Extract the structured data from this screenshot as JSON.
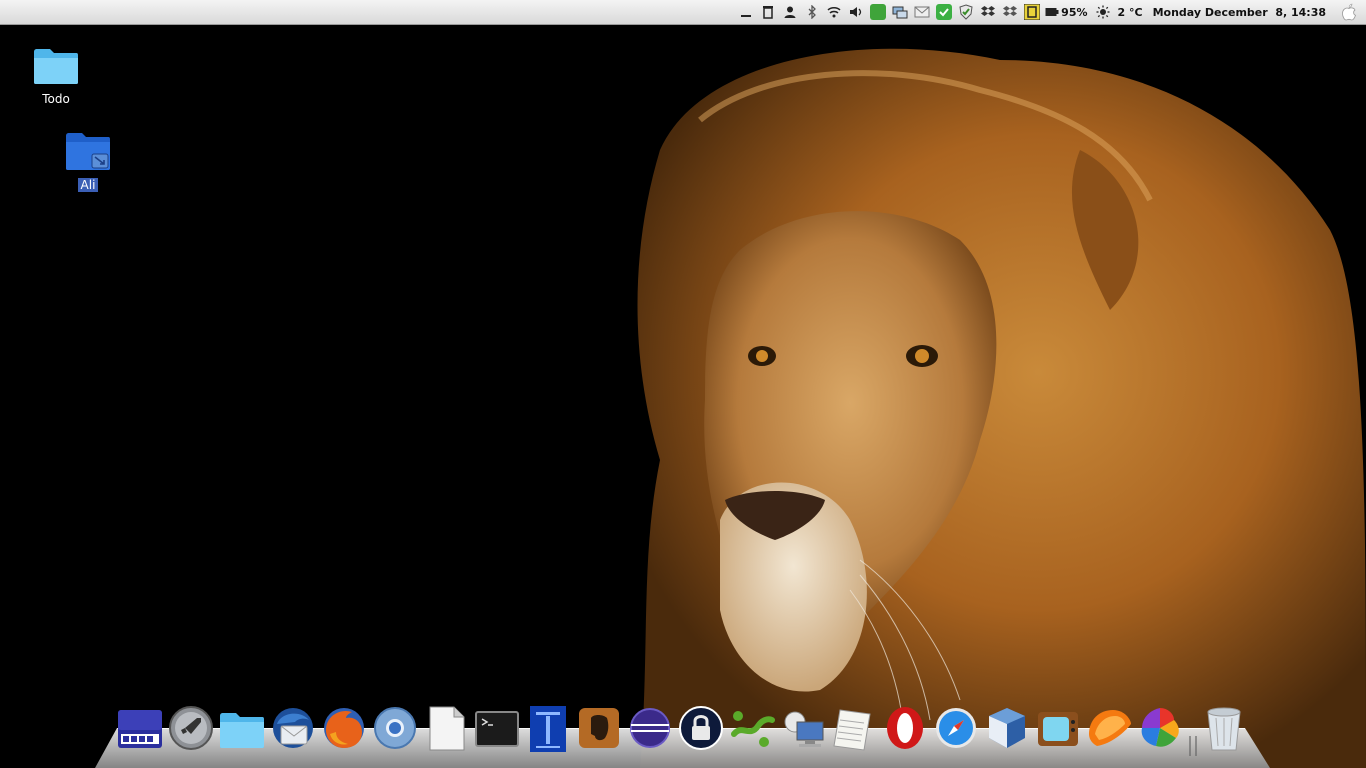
{
  "top_panel": {
    "tray_icons": [
      "minimize-window-icon",
      "trash-panel-icon",
      "user-icon",
      "bluetooth-icon",
      "wifi-icon",
      "volume-icon",
      "evernote-tray-icon",
      "network-tray-icon",
      "mail-tray-icon",
      "check-green-icon",
      "shield-check-icon",
      "dropbox-icon",
      "dropbox-alt-icon",
      "keyboard-layout-icon"
    ],
    "battery": "95%",
    "weather_icon": "sun-icon",
    "temperature": "2 °C",
    "clock": "Monday December  8, 14:38",
    "apple_menu_icon": "apple-icon"
  },
  "desktop": {
    "icons": [
      {
        "label": "Todo",
        "icon": "folder-light-blue-icon"
      },
      {
        "label": "Ali",
        "icon": "folder-link-blue-icon"
      }
    ]
  },
  "dock": {
    "items": [
      "screen-keyboard-icon",
      "launchpad-rocket-icon",
      "files-folder-icon",
      "thunderbird-icon",
      "firefox-icon",
      "chromium-icon",
      "text-document-icon",
      "terminal-icon",
      "typewriter-app-icon",
      "evernote-icon",
      "eclipse-icon",
      "password-lock-icon",
      "network-share-icon",
      "remote-desktop-icon",
      "notes-pad-icon",
      "opera-icon",
      "safari-compass-icon",
      "virtualbox-icon",
      "tv-app-icon",
      "orange-slice-icon",
      "picasa-icon",
      "trash-icon"
    ]
  },
  "colors": {
    "panel_bg": "#e6e6e6",
    "selection": "#3b5fb5",
    "folder_light": "#5ec8f5",
    "folder_blue": "#2a6fdc"
  }
}
